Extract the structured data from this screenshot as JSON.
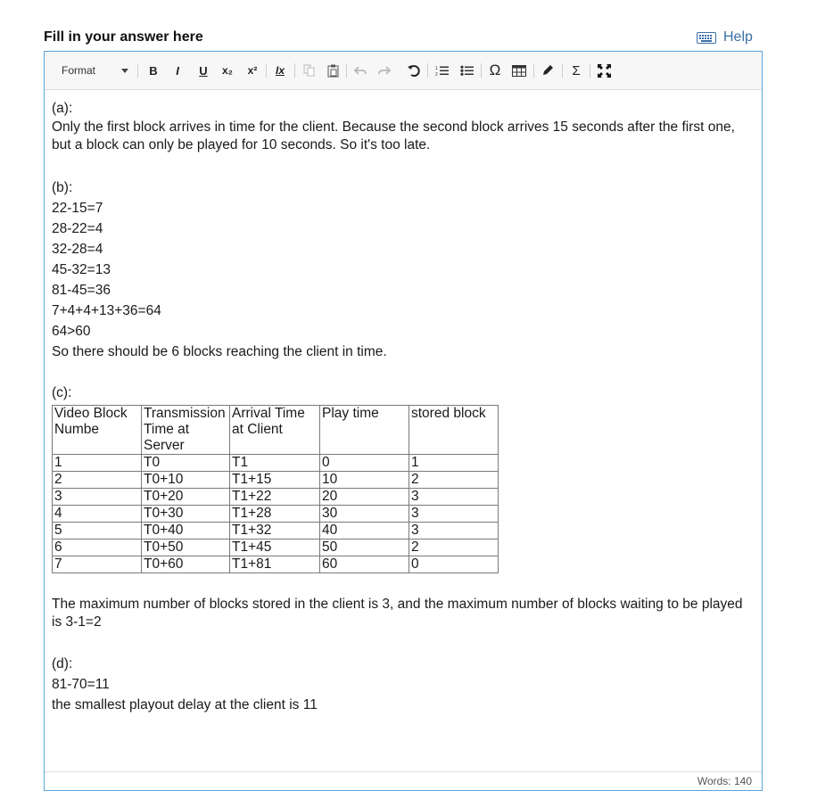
{
  "header": {
    "title": "Fill in your answer here",
    "help_label": "Help"
  },
  "toolbar": {
    "format_label": "Format",
    "bold": "B",
    "italic": "I",
    "underline": "U",
    "subscript": "x₂",
    "superscript": "x²",
    "clear_format": "Ix",
    "omega": "Ω",
    "sigma": "Σ"
  },
  "answer": {
    "a_heading": "(a):",
    "a_text": "Only the first block arrives in time for the client. Because the second block arrives 15 seconds after the first one, but a block can only be played for 10 seconds. So it's too late.",
    "b_heading": "(b):",
    "b_lines": [
      "22-15=7",
      "28-22=4",
      "32-28=4",
      "45-32=13",
      "81-45=36",
      "7+4+4+13+36=64",
      "64>60",
      "So there should be 6 blocks reaching the client in time."
    ],
    "c_heading": "(c):",
    "table": {
      "headers": [
        "Video Block Numbe",
        "Transmission Time at Server",
        "Arrival Time at Client",
        "Play time",
        "stored block"
      ],
      "rows": [
        [
          "1",
          "T0",
          "T1",
          "0",
          "1"
        ],
        [
          "2",
          "T0+10",
          "T1+15",
          "10",
          "2"
        ],
        [
          "3",
          "T0+20",
          "T1+22",
          "20",
          "3"
        ],
        [
          "4",
          "T0+30",
          "T1+28",
          "30",
          "3"
        ],
        [
          "5",
          "T0+40",
          "T1+32",
          "40",
          "3"
        ],
        [
          "6",
          "T0+50",
          "T1+45",
          "50",
          "2"
        ],
        [
          "7",
          "T0+60",
          "T1+81",
          "60",
          "0"
        ]
      ]
    },
    "c_text": "The maximum number of blocks stored in the client is 3, and the maximum number of blocks waiting to be played is 3-1=2",
    "d_heading": "(d):",
    "d_lines": [
      "81-70=11",
      "the smallest playout delay at the client is 11"
    ]
  },
  "footer": {
    "word_count": "Words: 140"
  },
  "colors": {
    "accent": "#5ba3d9",
    "link": "#3a6ea5"
  }
}
